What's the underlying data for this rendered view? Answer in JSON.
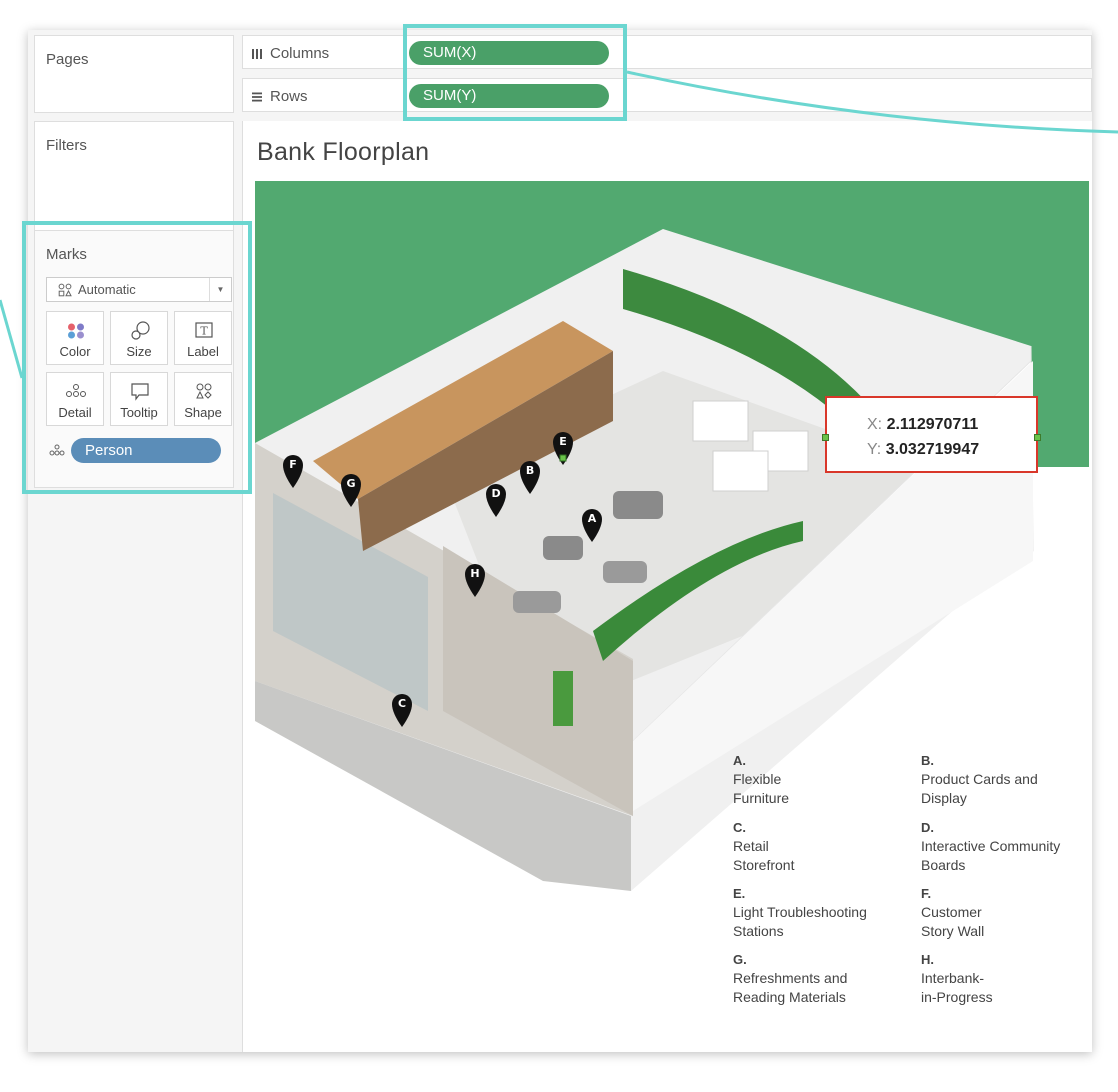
{
  "panels": {
    "pages_title": "Pages",
    "filters_title": "Filters",
    "marks_title": "Marks"
  },
  "shelves": {
    "columns": {
      "label": "Columns",
      "pill": "SUM(X)"
    },
    "rows": {
      "label": "Rows",
      "pill": "SUM(Y)"
    }
  },
  "marks": {
    "type": "Automatic",
    "buttons": {
      "color": "Color",
      "size": "Size",
      "label": "Label",
      "detail": "Detail",
      "tooltip": "Tooltip",
      "shape": "Shape"
    },
    "field": "Person"
  },
  "viz": {
    "title": "Bank Floorplan",
    "tooltip": {
      "x_key": "X:",
      "x_value": "2.112970711",
      "y_key": "Y:",
      "y_value": "3.032719947"
    },
    "pins": [
      "A",
      "B",
      "C",
      "D",
      "E",
      "F",
      "G",
      "H"
    ],
    "legend": [
      {
        "letter": "A.",
        "lines": [
          "Flexible",
          "Furniture"
        ]
      },
      {
        "letter": "B.",
        "lines": [
          "Product Cards and",
          "Display"
        ]
      },
      {
        "letter": "C.",
        "lines": [
          "Retail",
          "Storefront"
        ]
      },
      {
        "letter": "D.",
        "lines": [
          "Interactive Community",
          "Boards"
        ]
      },
      {
        "letter": "E.",
        "lines": [
          "Light Troubleshooting",
          "Stations"
        ]
      },
      {
        "letter": "F.",
        "lines": [
          "Customer",
          "Story Wall"
        ]
      },
      {
        "letter": "G.",
        "lines": [
          "Refreshments and",
          "Reading Materials"
        ]
      },
      {
        "letter": "H.",
        "lines": [
          "Interbank-",
          "in-Progress"
        ]
      }
    ]
  },
  "colors": {
    "pill_green": "#4aa068",
    "pill_blue": "#5b8db8",
    "highlight": "#6bd6d0",
    "floor_green": "#52a970",
    "tooltip_border": "#d9372a"
  }
}
